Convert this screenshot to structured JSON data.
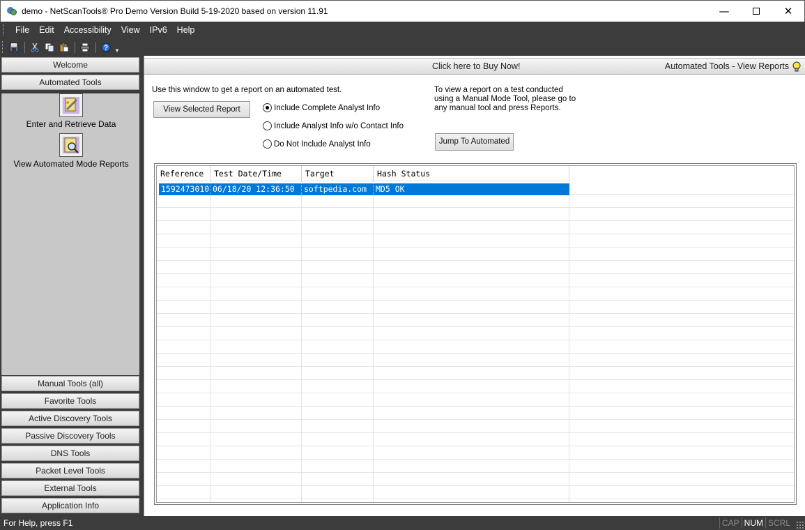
{
  "window": {
    "title": "demo - NetScanTools® Pro Demo Version Build 5-19-2020 based on version 11.91"
  },
  "menu": [
    "File",
    "Edit",
    "Accessibility",
    "View",
    "IPv6",
    "Help"
  ],
  "toolbar": {
    "icons": [
      "save-icon",
      "cut-icon",
      "copy-icon",
      "paste-icon",
      "print-icon",
      "help-icon"
    ]
  },
  "sidebar": {
    "top_buttons": [
      "Welcome",
      "Automated Tools"
    ],
    "tools": [
      {
        "label": "Enter and Retrieve Data",
        "icon": "enter-data-icon"
      },
      {
        "label": "View Automated Mode Reports",
        "icon": "view-reports-icon"
      }
    ],
    "bottom_buttons": [
      "Manual Tools (all)",
      "Favorite Tools",
      "Active Discovery Tools",
      "Passive Discovery Tools",
      "DNS Tools",
      "Packet Level Tools",
      "External Tools",
      "Application Info"
    ]
  },
  "header": {
    "buy_now": "Click here to Buy Now!",
    "breadcrumb": "Automated Tools - View Reports"
  },
  "content": {
    "intro": "Use this window to get a report on an automated test.",
    "note_lines": [
      "To view a report on a test conducted",
      "using a Manual Mode Tool, please go to",
      "any manual tool and press Reports."
    ],
    "view_report_button": "View Selected Report",
    "jump_button": "Jump To Automated",
    "radios": [
      {
        "label": "Include Complete Analyst Info",
        "selected": true
      },
      {
        "label": "Include Analyst Info w/o Contact Info",
        "selected": false
      },
      {
        "label": "Do Not Include Analyst Info",
        "selected": false
      }
    ]
  },
  "table": {
    "columns": [
      "Reference",
      "Test Date/Time",
      "Target",
      "Hash Status"
    ],
    "rows": [
      [
        "1592473010",
        "06/18/20 12:36:50",
        "softpedia.com",
        "MD5 OK"
      ]
    ]
  },
  "statusbar": {
    "help_text": "For Help, press F1",
    "indicators": [
      {
        "label": "CAP",
        "active": false
      },
      {
        "label": "NUM",
        "active": true
      },
      {
        "label": "SCRL",
        "active": false
      }
    ]
  },
  "colors": {
    "selection": "#0078d7",
    "chrome": "#3c3c3c"
  }
}
